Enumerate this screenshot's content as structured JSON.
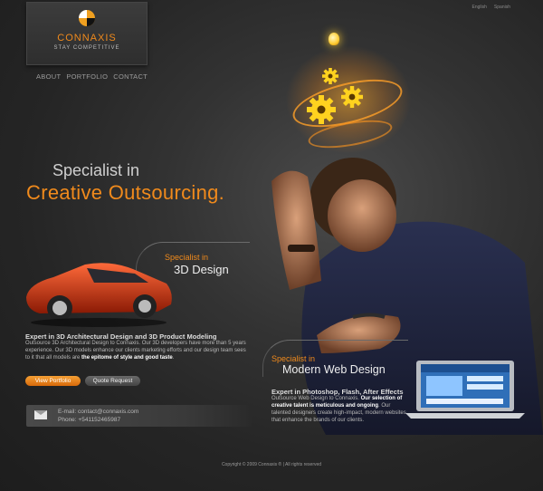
{
  "language": {
    "english": "English",
    "spanish": "Spanish"
  },
  "logo": {
    "name": "CONNAXIS",
    "tagline": "STAY COMPETITIVE"
  },
  "nav": [
    "ABOUT",
    "PORTFOLIO",
    "CONTACT"
  ],
  "hero": {
    "line1": "Specialist in",
    "line2": "Creative Outsourcing."
  },
  "design3d": {
    "small": "Specialist in",
    "big": "3D Design",
    "title": "Expert in 3D Architectural Design and 3D Product Modeling",
    "text": "Outsource 3D Architectural Design to Connaxis. Our 3D developers have more than 5 years experience. Our 3D models enhance our clients marketing efforts and our design team sees to it that all models are",
    "text_bold": "the epitome of style and good taste",
    "text_end": "."
  },
  "web": {
    "small": "Specialist in",
    "big": "Modern Web Design",
    "title": "Expert in Photoshop, Flash, After Effects",
    "text_a": "Outsource Web Design to Connaxis.",
    "text_bold": "Our selection of creative talent is meticulous and ongoing",
    "text_b": ". Our talented designers create high-impact, modern websites that enhance the brands of our clients."
  },
  "buttons": {
    "portfolio": "View Portfolio",
    "quote": "Quote Request"
  },
  "contact": {
    "email": "E-mail: contact@connaxis.com",
    "phone": "Phone: +541152465987"
  },
  "footer": "Copyright © 2009 Connaxis ® | All rights reserved",
  "colors": {
    "accent": "#f08a1c",
    "background": "#1f1f1f"
  }
}
